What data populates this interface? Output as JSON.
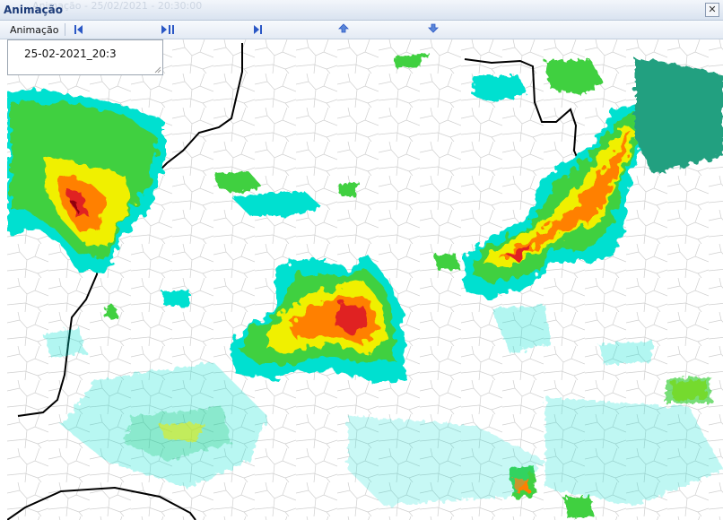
{
  "window": {
    "title": "Animação",
    "ghost_title": "Animação - 25/02/2021 - 20:30:00",
    "close_label": "✕"
  },
  "toolbar": {
    "label": "Animação",
    "buttons": [
      {
        "name": "first-frame-button",
        "icon": "skip-to-start-icon"
      },
      {
        "name": "play-pause-button",
        "icon": "play-pause-icon"
      },
      {
        "name": "next-frame-button",
        "icon": "step-forward-icon"
      },
      {
        "name": "speed-up-button",
        "icon": "arrow-up-icon"
      },
      {
        "name": "speed-down-button",
        "icon": "arrow-down-icon"
      }
    ]
  },
  "timestamp": {
    "value": "25-02-2021_20:3"
  },
  "map": {
    "description_icon": "weather-radar-map",
    "colors": {
      "weak": "#00e0d0",
      "light": "#00c060",
      "moderate": "#40d040",
      "strong": "#f0f000",
      "heavy": "#ff8000",
      "intense": "#e02020",
      "extreme": "#900010",
      "teal": "#20a080",
      "border": "#000000",
      "municipal": "#c8c8c8"
    }
  }
}
